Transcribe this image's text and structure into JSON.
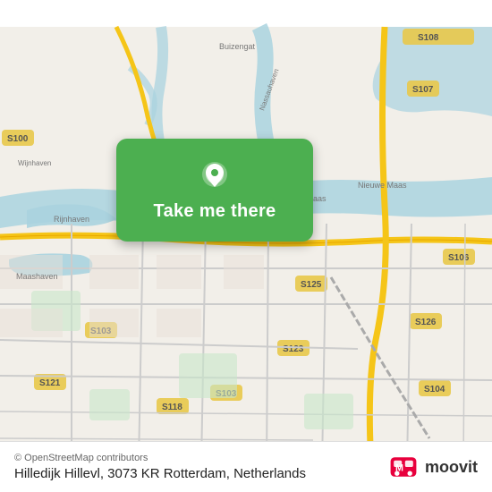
{
  "map": {
    "center_lat": 51.905,
    "center_lon": 4.47,
    "city": "Rotterdam",
    "country": "Netherlands"
  },
  "action_button": {
    "label": "Take me there"
  },
  "bottom_bar": {
    "copyright": "© OpenStreetMap contributors",
    "address": "Hilledijk Hillevl, 3073 KR Rotterdam, Netherlands"
  },
  "moovit": {
    "label": "moovit"
  },
  "icons": {
    "location_pin": "location-pin-icon",
    "moovit_logo": "moovit-logo-icon"
  }
}
